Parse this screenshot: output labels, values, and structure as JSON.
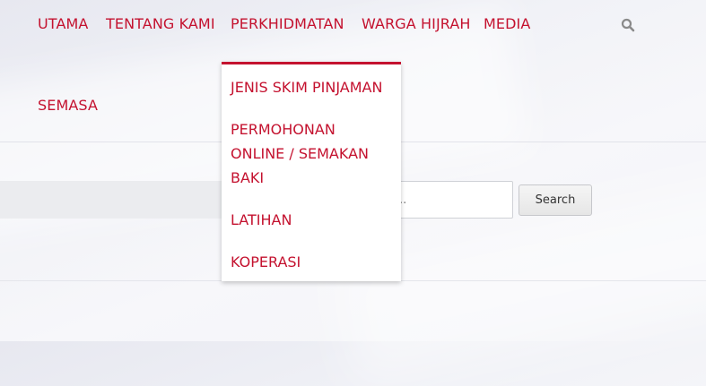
{
  "nav": {
    "items": [
      {
        "label": "UTAMA"
      },
      {
        "label": "TENTANG KAMI"
      },
      {
        "label": "PERKHIDMATAN"
      },
      {
        "label": "WARGA HIJRAH"
      },
      {
        "label": "MEDIA"
      },
      {
        "label": "SEMASA"
      }
    ],
    "search_icon": "search-icon"
  },
  "dropdown": {
    "items": [
      {
        "label": "JENIS SKIM PINJAMAN"
      },
      {
        "label": "PERMOHONAN ONLINE / SEMAKAN BAKI"
      },
      {
        "label": "LATIHAN"
      },
      {
        "label": "KOPERASI"
      }
    ]
  },
  "search": {
    "value": "..",
    "button_label": "Search"
  },
  "colors": {
    "accent": "#c4122f",
    "icon": "#8a8a8a"
  }
}
